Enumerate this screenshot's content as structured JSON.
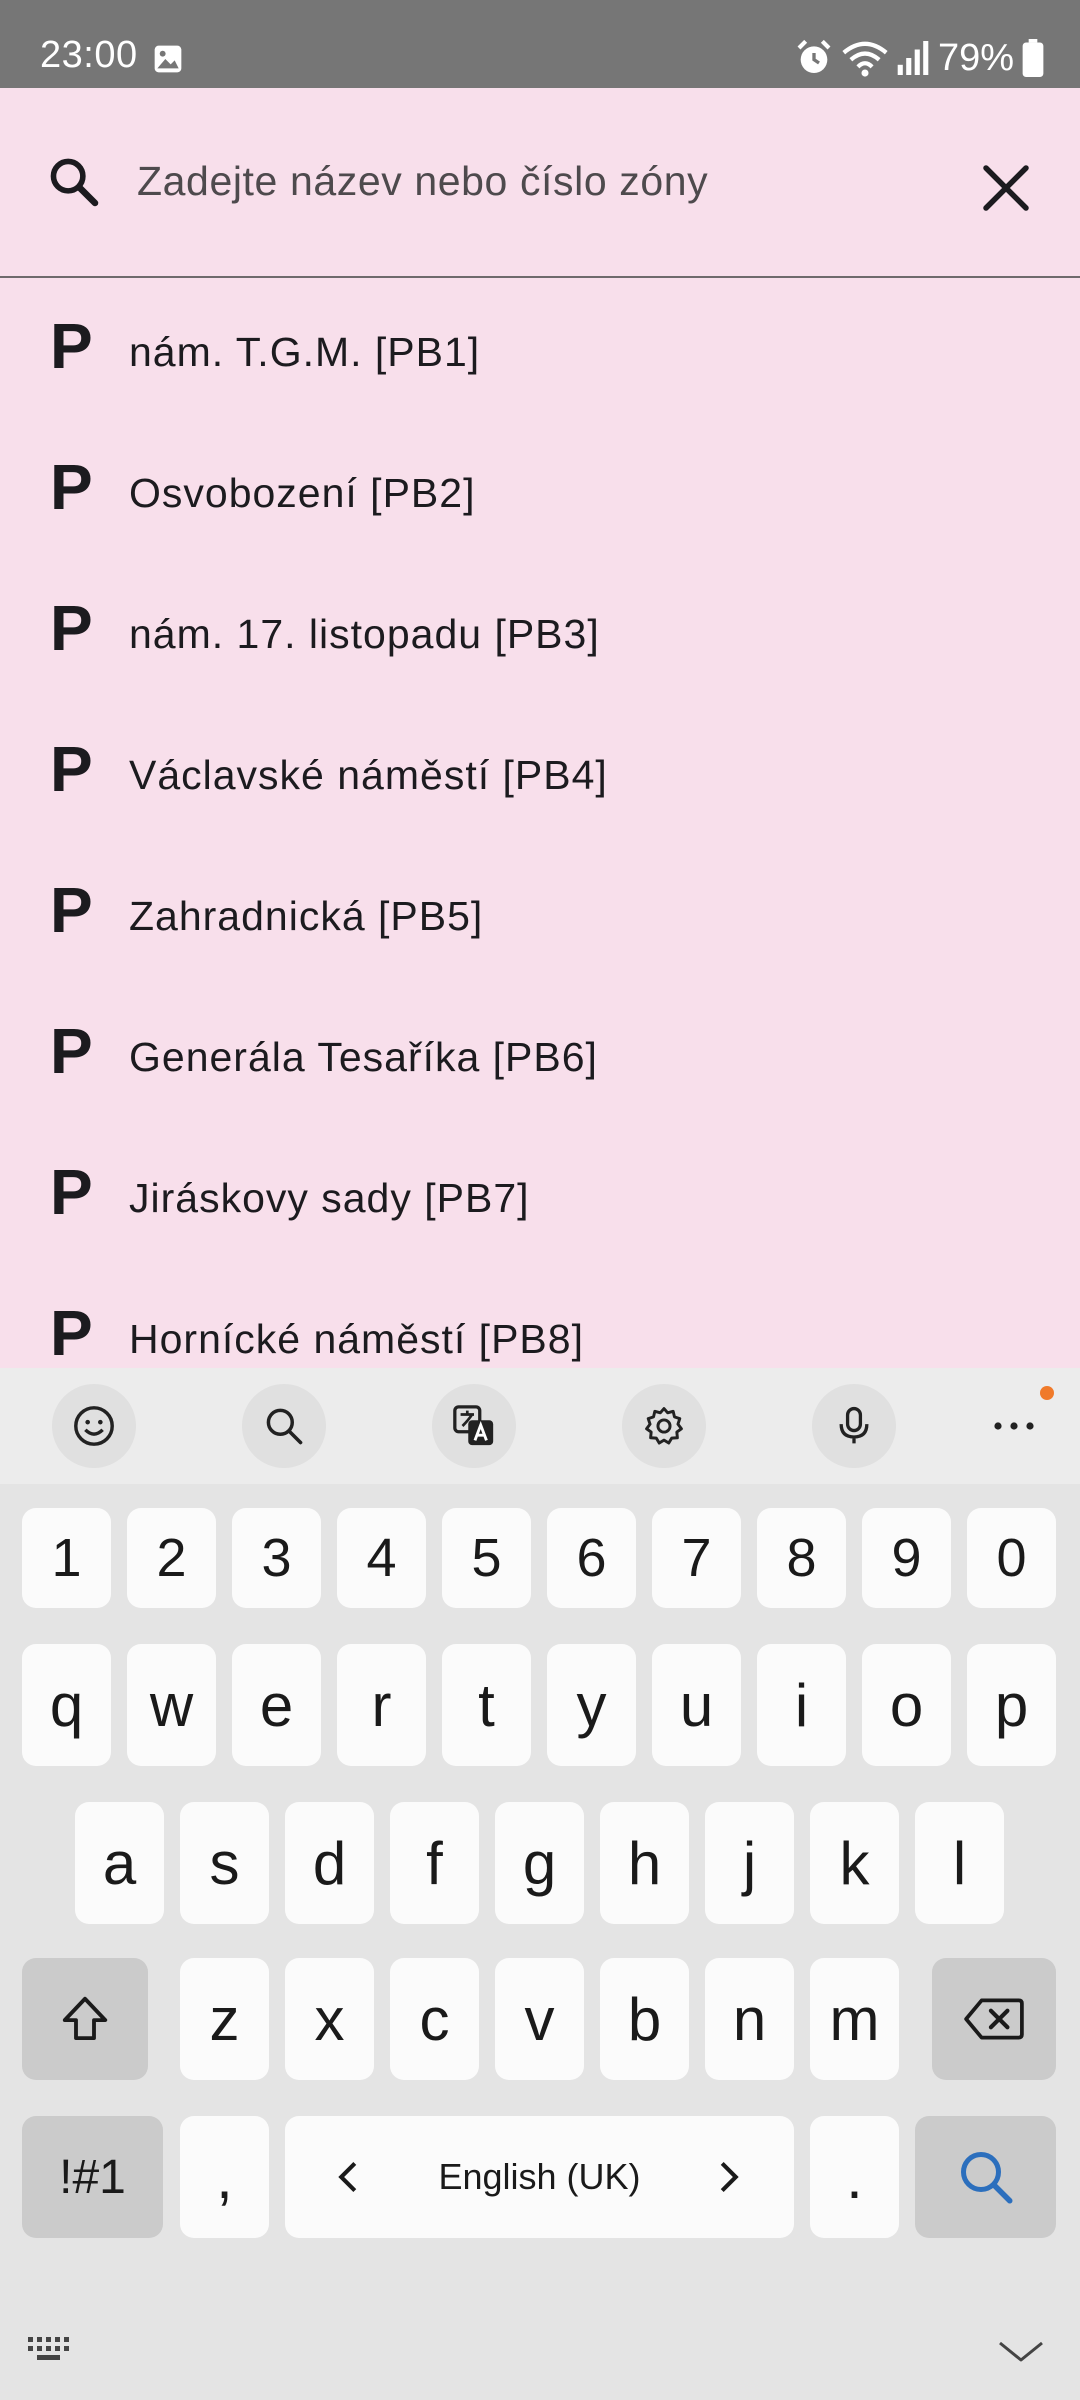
{
  "status_bar": {
    "time": "23:00",
    "battery": "79%",
    "icons": [
      "gallery-icon",
      "alarm-icon",
      "wifi-icon",
      "signal-icon",
      "battery-icon"
    ]
  },
  "search": {
    "placeholder": "Zadejte název nebo číslo zóny",
    "value": ""
  },
  "zones": [
    {
      "icon": "P",
      "label": "nám. T.G.M. [PB1]"
    },
    {
      "icon": "P",
      "label": "Osvobození [PB2]"
    },
    {
      "icon": "P",
      "label": "nám. 17. listopadu [PB3]"
    },
    {
      "icon": "P",
      "label": "Václavské náměstí [PB4]"
    },
    {
      "icon": "P",
      "label": "Zahradnická [PB5]"
    },
    {
      "icon": "P",
      "label": "Generála Tesaříka [PB6]"
    },
    {
      "icon": "P",
      "label": "Jiráskovy sady [PB7]"
    },
    {
      "icon": "P",
      "label": "Hornícké náměstí [PB8]"
    }
  ],
  "keyboard": {
    "toolbar": [
      "emoji-icon",
      "search-icon",
      "translate-icon",
      "settings-icon",
      "mic-icon",
      "more-icon"
    ],
    "numbers": [
      "1",
      "2",
      "3",
      "4",
      "5",
      "6",
      "7",
      "8",
      "9",
      "0"
    ],
    "row1": [
      "q",
      "w",
      "e",
      "r",
      "t",
      "y",
      "u",
      "i",
      "o",
      "p"
    ],
    "row2": [
      "a",
      "s",
      "d",
      "f",
      "g",
      "h",
      "j",
      "k",
      "l"
    ],
    "row3": [
      "z",
      "x",
      "c",
      "v",
      "b",
      "n",
      "m"
    ],
    "symbols_key": "!#1",
    "comma_key": ",",
    "space_label": "English (UK)",
    "period_key": ".",
    "colors": {
      "accent": "#2c6fbd",
      "notification_dot": "#f07a2a",
      "app_background": "#f8dfeb"
    }
  }
}
